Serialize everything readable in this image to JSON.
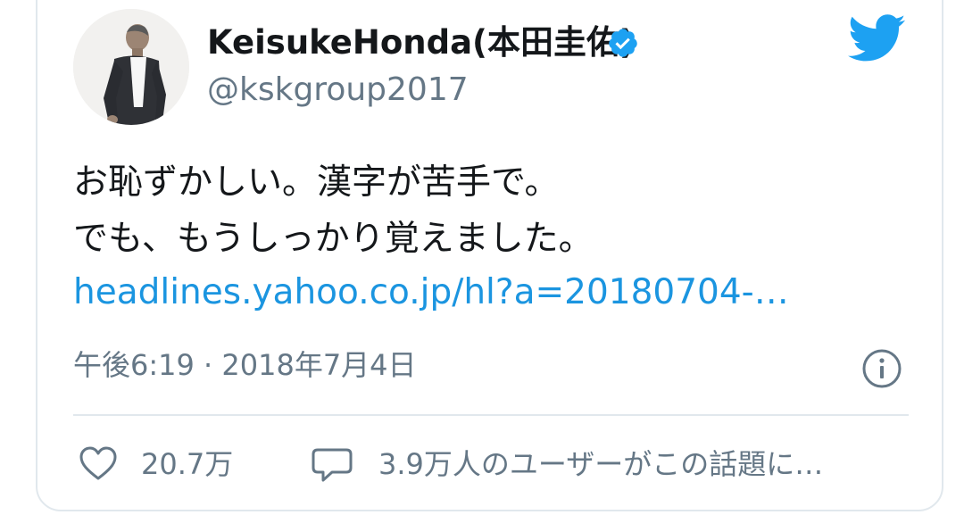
{
  "author": {
    "display_name": "KeisukeHonda(本田圭佑)",
    "handle": "@kskgroup2017",
    "avatar_icon": "person-photo-icon",
    "verified_icon": "verified-badge-icon"
  },
  "brand": {
    "logo_icon": "twitter-bird-icon",
    "color": "#1da1f2"
  },
  "tweet": {
    "lines": [
      "お恥ずかしい。漢字が苦手で。",
      "でも、もうしっかり覚えました。"
    ],
    "link": "headlines.yahoo.co.jp/hl?a=20180704-…",
    "link_color": "#1b95e0"
  },
  "meta": {
    "timestamp": "午後6:19 · 2018年7月4日",
    "info_icon": "info-icon"
  },
  "actions": {
    "like_icon": "heart-icon",
    "like_count": "20.7万",
    "reply_icon": "speech-bubble-icon",
    "reply_text": "3.9万人のユーザーがこの話題に…"
  },
  "colors": {
    "text_primary": "#14171a",
    "text_secondary": "#657786",
    "border": "#e1e8ed"
  }
}
